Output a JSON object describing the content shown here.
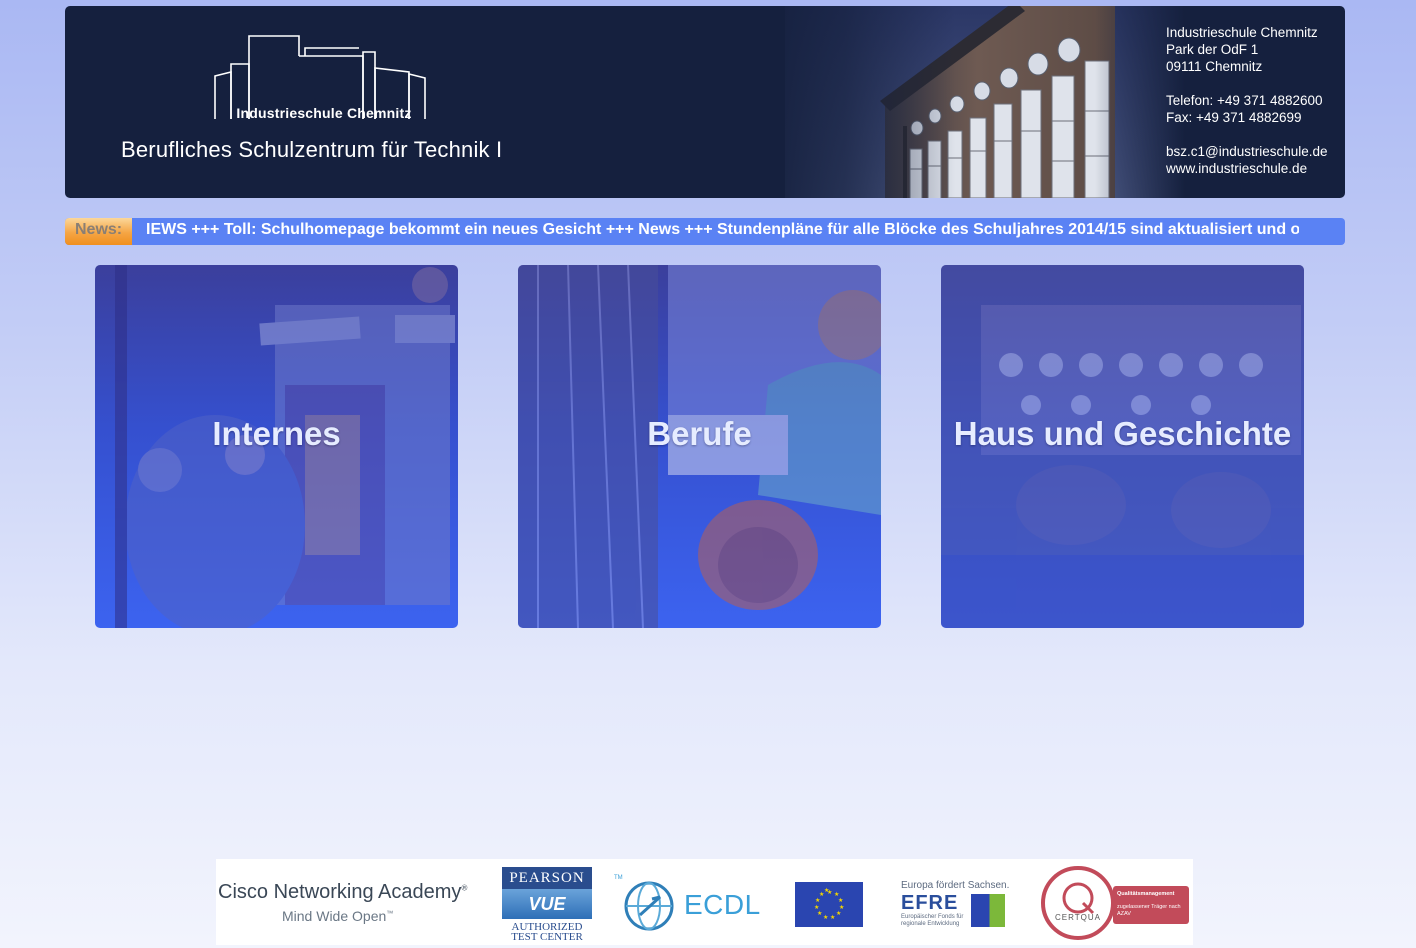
{
  "header": {
    "school_name": "Industrieschule Chemnitz",
    "subtitle": "Berufliches Schulzentrum für Technik I",
    "contact": {
      "name": "Industrieschule Chemnitz",
      "street": "Park der OdF 1",
      "city": "09111 Chemnitz",
      "phone": "Telefon: +49 371 4882600",
      "fax": "Fax: +49 371 4882699",
      "email": "bsz.c1@industrieschule.de",
      "web": "www.industrieschule.de"
    }
  },
  "news": {
    "label": "News:",
    "text": "IEWS +++ Toll: Schulhomepage bekommt ein neues Gesicht +++ News +++ Stundenpläne für alle Blöcke des Schuljahres 2014/15 sind aktualisiert und o"
  },
  "tiles": [
    {
      "label": "Internes"
    },
    {
      "label": "Berufe"
    },
    {
      "label": "Haus und Geschichte"
    }
  ],
  "partners": {
    "cisco_main": "Cisco Networking Academy",
    "cisco_reg": "®",
    "cisco_sub": "Mind Wide Open",
    "cisco_tm": "™",
    "pearson_top": "PEARSON",
    "pearson_mid": "VUE",
    "pearson_bottom_1": "AUTHORIZED",
    "pearson_bottom_2": "TEST CENTER",
    "ecdl": "ECDL",
    "ecdl_tm": "TM",
    "efre_top": "Europa fördert Sachsen.",
    "efre_main": "EFRE",
    "efre_sub": "Europäischer Fonds für regionale Entwicklung",
    "certqua_ring": "CERTQUA",
    "certqua_box_1": "Qualitätsmanagement",
    "certqua_box_2": "zugelassener Träger nach AZAV"
  },
  "colors": {
    "header_bg": "#15203e",
    "ticker_bg": "#5a82f4",
    "ticker_tag": "#f5a544",
    "tile_overlay": "#3c5ee8"
  }
}
